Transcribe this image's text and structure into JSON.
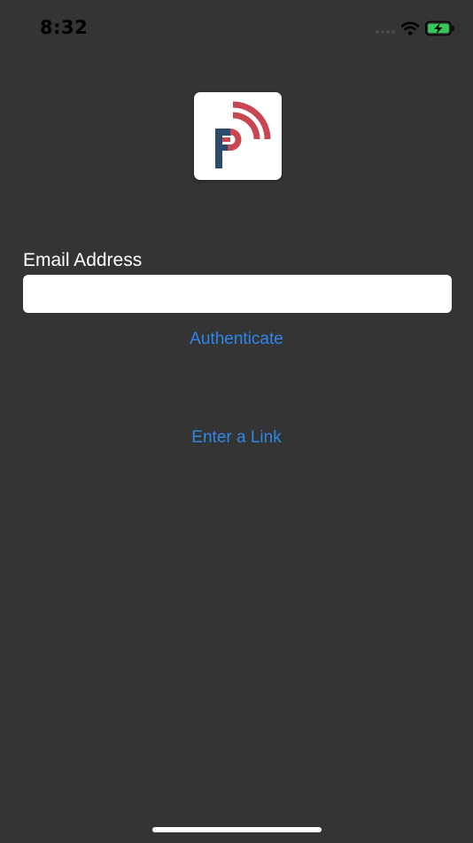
{
  "status_bar": {
    "time": "8:32"
  },
  "colors": {
    "background": "#343434",
    "accent": "#2f86e8",
    "logo_navy": "#2c4a6b",
    "logo_red": "#c94653",
    "battery_green": "#35c759"
  },
  "logo": {
    "icon": "app-logo-icon"
  },
  "form": {
    "email_label": "Email Address",
    "email_value": "",
    "authenticate_label": "Authenticate",
    "enter_link_label": "Enter a Link"
  }
}
